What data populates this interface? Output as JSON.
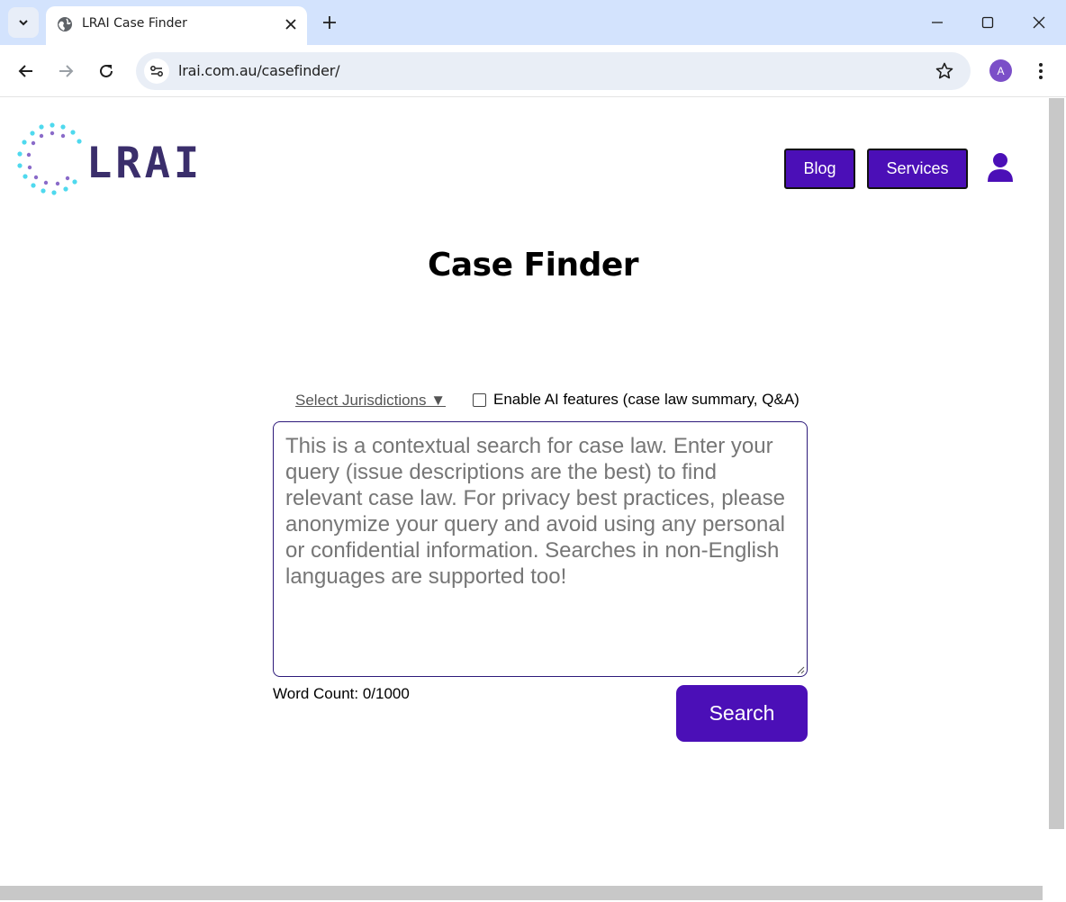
{
  "browser": {
    "tab_title": "LRAI Case Finder",
    "url": "lrai.com.au/casefinder/",
    "profile_initial": "A",
    "icons": [
      "tab-search-icon",
      "globe-icon",
      "close-icon",
      "plus-icon",
      "minimize-icon",
      "maximize-icon",
      "window-close-icon",
      "back-arrow-icon",
      "forward-arrow-icon",
      "reload-icon",
      "site-info-icon",
      "star-icon",
      "menu-dots-icon"
    ]
  },
  "header": {
    "logo_text": "LRAI",
    "nav": [
      {
        "label": "Blog"
      },
      {
        "label": "Services"
      }
    ],
    "user_icon": "user-icon"
  },
  "main": {
    "title": "Case Finder",
    "jurisdictions_label": "Select Jurisdictions ▼",
    "ai_checkbox_label": "Enable AI features (case law summary, Q&A)",
    "ai_checkbox_checked": false,
    "query_placeholder": "This is a contextual search for case law. Enter your query (issue descriptions are the best) to find relevant case law. For privacy best practices, please anonymize your query and avoid using any personal or confidential information. Searches in non-English languages are supported too!",
    "query_value": "",
    "word_count": "Word Count: 0/1000",
    "search_label": "Search"
  },
  "colors": {
    "accent": "#4b0fb7",
    "logo_text": "#3a2e6b",
    "tabstrip": "#d3e3fd"
  }
}
